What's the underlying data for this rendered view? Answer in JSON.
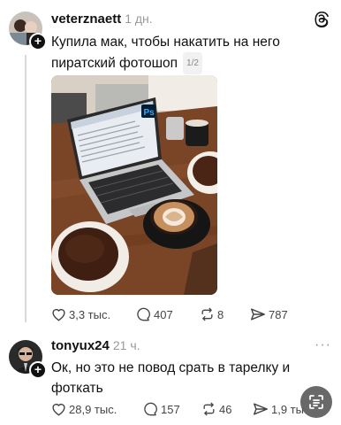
{
  "icons": {
    "app_logo": "threads-logo-icon",
    "follow": "plus-icon",
    "like": "heart-icon",
    "comment": "comment-icon",
    "repost": "repost-icon",
    "share": "send-icon",
    "more": "more-icon",
    "floating": "scan-text-icon"
  },
  "post": {
    "username": "veterznaett",
    "time": "1 дн.",
    "text_line1": "Купила мак, чтобы накатить на него",
    "text_line2": "пиратский фотошоп",
    "image_counter": "1/2",
    "image_alt": "Ноутбук на столе с кофе и пончиками",
    "laptop_badge": "Ps",
    "stats": {
      "likes": "3,3 тыс.",
      "comments": "407",
      "reposts": "8",
      "shares": "787"
    }
  },
  "reply": {
    "username": "tonyux24",
    "time": "21 ч.",
    "text_line1": "Ок, но это не повод срать в тарелку и",
    "text_line2": "фоткать",
    "stats": {
      "likes": "28,9 тыс.",
      "comments": "157",
      "reposts": "46",
      "shares": "1,9 ты"
    }
  },
  "colors": {
    "ps_blue": "#31a8ff",
    "ps_bg": "#001e36"
  }
}
